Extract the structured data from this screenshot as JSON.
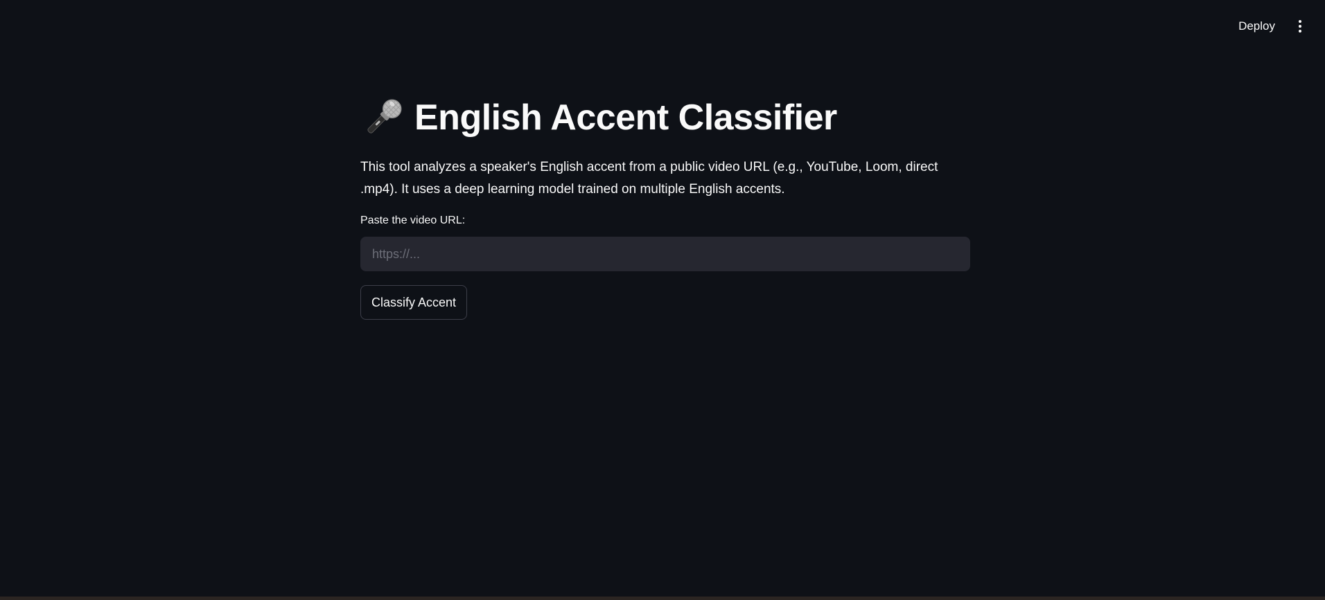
{
  "header": {
    "deploy_label": "Deploy",
    "menu_icon": "vertical-ellipsis-icon"
  },
  "main": {
    "title_icon": "microphone-icon",
    "title": "English Accent Classifier",
    "description": "This tool analyzes a speaker's English accent from a public video URL (e.g., YouTube, Loom, direct .mp4). It uses a deep learning model trained on multiple English accents.",
    "url_field": {
      "label": "Paste the video URL:",
      "placeholder": "https://...",
      "value": ""
    },
    "classify_button_label": "Classify Accent"
  },
  "colors": {
    "background": "#0e1117",
    "input_background": "#262730",
    "text": "#fafafa",
    "placeholder": "#6c6e78",
    "button_border": "#3d3f4a"
  }
}
